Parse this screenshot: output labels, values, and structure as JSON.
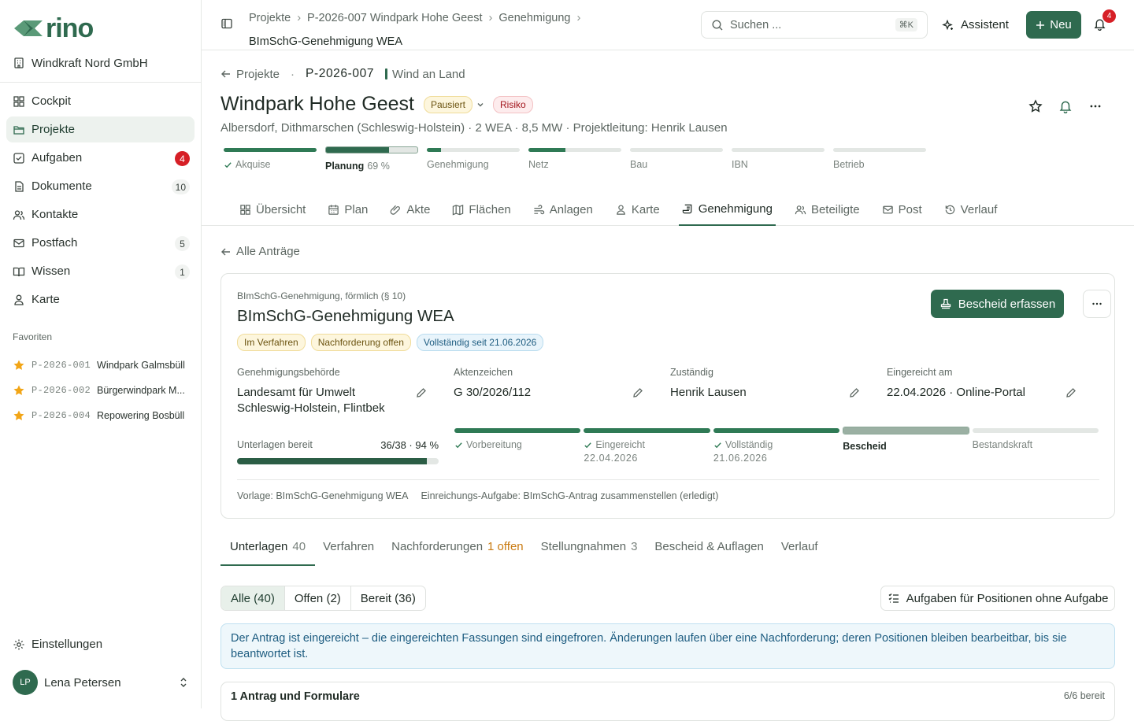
{
  "brand": {
    "name": "rino",
    "accent": "#2f6a4f"
  },
  "sidebar": {
    "org": "Windkraft Nord GmbH",
    "items": [
      {
        "label": "Cockpit",
        "icon": "grid-icon"
      },
      {
        "label": "Projekte",
        "icon": "folder-icon",
        "active": true
      },
      {
        "label": "Aufgaben",
        "icon": "checkbox-icon",
        "badge": "4"
      },
      {
        "label": "Dokumente",
        "icon": "document-icon",
        "badge": "10"
      },
      {
        "label": "Kontakte",
        "icon": "contacts-icon"
      },
      {
        "label": "Postfach",
        "icon": "mail-icon",
        "badge": "5"
      },
      {
        "label": "Wissen",
        "icon": "book-icon",
        "badge": "1"
      },
      {
        "label": "Karte",
        "icon": "map-pin-icon"
      }
    ],
    "favorites_heading": "Favoriten",
    "favorites": [
      {
        "code": "P-2026-001",
        "name": "Windpark Galmsbüll"
      },
      {
        "code": "P-2026-002",
        "name": "Bürgerwindpark M..."
      },
      {
        "code": "P-2026-004",
        "name": "Repowering Bosbüll"
      }
    ],
    "settings": "Einstellungen",
    "user": {
      "initials": "LP",
      "name": "Lena Petersen"
    }
  },
  "topbar": {
    "breadcrumbs": [
      "Projekte",
      "P-2026-007 Windpark Hohe Geest",
      "Genehmigung",
      "BImSchG-Genehmigung WEA"
    ],
    "search_placeholder": "Suchen ...",
    "search_shortcut": "⌘K",
    "assistant": "Assistent",
    "new": "Neu",
    "notifications": "4"
  },
  "project": {
    "back": "Projekte",
    "code": "P-2026-007",
    "category": "Wind an Land",
    "title": "Windpark Hohe Geest",
    "status": "Pausiert",
    "risk": "Risiko",
    "subtitle": "Albersdorf, Dithmarschen (Schleswig-Holstein) · 2 WEA · 8,5 MW · Projektleitung: Henrik Lausen",
    "phases": [
      {
        "label": "Akquise",
        "progress": 1.0,
        "done": true
      },
      {
        "label": "Planung",
        "progress": 0.69,
        "current": true,
        "pct": "69 %"
      },
      {
        "label": "Genehmigung",
        "progress": 0.15
      },
      {
        "label": "Netz",
        "progress": 0.4
      },
      {
        "label": "Bau",
        "progress": 0
      },
      {
        "label": "IBN",
        "progress": 0
      },
      {
        "label": "Betrieb",
        "progress": 0
      }
    ],
    "tabs": [
      "Übersicht",
      "Plan",
      "Akte",
      "Flächen",
      "Anlagen",
      "Karte",
      "Genehmigung",
      "Beteiligte",
      "Post",
      "Verlauf"
    ],
    "active_tab": "Genehmigung"
  },
  "application": {
    "back": "Alle Anträge",
    "type": "BImSchG-Genehmigung, förmlich (§ 10)",
    "title": "BImSchG-Genehmigung WEA",
    "badges": [
      "Im Verfahren",
      "Nachforderung offen",
      "Vollständig seit 21.06.2026"
    ],
    "action": "Bescheid erfassen",
    "fields": [
      {
        "label": "Genehmigungsbehörde",
        "value": "Landesamt für Umwelt Schleswig-Holstein, Flintbek"
      },
      {
        "label": "Aktenzeichen",
        "value": "G 30/2026/112"
      },
      {
        "label": "Zuständig",
        "value": "Henrik Lausen"
      },
      {
        "label": "Eingereicht am",
        "value": "22.04.2026 · Online-Portal"
      }
    ],
    "docs_label": "Unterlagen bereit",
    "docs_value": "36/38 · 94 %",
    "docs_progress": 0.94,
    "steps": [
      {
        "label": "Vorbereitung",
        "date": "",
        "progress": 1.0,
        "done": true
      },
      {
        "label": "Eingereicht",
        "date": "22.04.2026",
        "progress": 1.0,
        "done": true
      },
      {
        "label": "Vollständig",
        "date": "21.06.2026",
        "progress": 1.0,
        "done": true
      },
      {
        "label": "Bescheid",
        "date": "",
        "progress": 1.0,
        "current": true
      },
      {
        "label": "Bestandskraft",
        "date": "",
        "progress": 0
      }
    ],
    "template": "Vorlage: BImSchG-Genehmigung WEA",
    "submission_task": "Einreichungs-Aufgabe: BImSchG-Antrag zusammenstellen (erledigt)"
  },
  "subtabs": [
    {
      "label": "Unterlagen",
      "extra": "40",
      "active": true
    },
    {
      "label": "Verfahren",
      "extra": ""
    },
    {
      "label": "Nachforderungen",
      "extra": "1 offen",
      "orange": true
    },
    {
      "label": "Stellungnahmen",
      "extra": "3"
    },
    {
      "label": "Bescheid & Auflagen",
      "extra": ""
    },
    {
      "label": "Verlauf",
      "extra": ""
    }
  ],
  "filters": [
    "Alle (40)",
    "Offen (2)",
    "Bereit (36)"
  ],
  "tasks_button": "Aufgaben für Positionen ohne Aufgabe",
  "info": "Der Antrag ist eingereicht – die eingereichten Fassungen sind eingefroren. Änderungen laufen über eine Nachforderung; deren Positionen bleiben bearbeitbar, bis sie beantwortet ist.",
  "section": {
    "title": "1 Antrag und Formulare",
    "status": "6/6 bereit"
  }
}
